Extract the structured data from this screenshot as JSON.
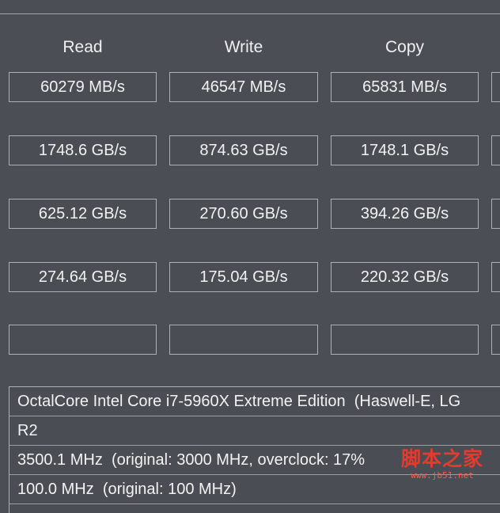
{
  "columns": {
    "read": "Read",
    "write": "Write",
    "copy": "Copy"
  },
  "rows": [
    {
      "read": "60279 MB/s",
      "write": "46547 MB/s",
      "copy": "65831 MB/s"
    },
    {
      "read": "1748.6 GB/s",
      "write": "874.63 GB/s",
      "copy": "1748.1 GB/s"
    },
    {
      "read": "625.12 GB/s",
      "write": "270.60 GB/s",
      "copy": "394.26 GB/s"
    },
    {
      "read": "274.64 GB/s",
      "write": "175.04 GB/s",
      "copy": "220.32 GB/s"
    },
    {
      "read": "",
      "write": "",
      "copy": ""
    }
  ],
  "cpu_info": {
    "name": "OctalCore Intel Core i7-5960X Extreme Edition  (Haswell-E, LG",
    "stepping": "R2",
    "clock": "3500.1 MHz  (original: 3000 MHz, overclock: 17%",
    "bus": "100.0 MHz  (original: 100 MHz)"
  },
  "watermark": {
    "text": "脚本之家",
    "url": "www.jb51.net"
  },
  "colors": {
    "background": "#4b4e54",
    "border": "#aeb0b4",
    "text": "#f2f2f2",
    "watermark": "#e53a2f"
  }
}
